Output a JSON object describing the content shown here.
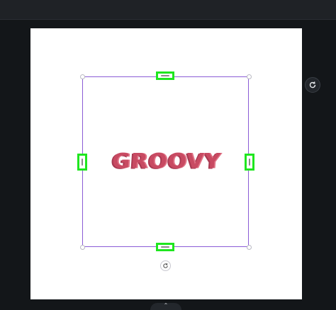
{
  "canvas": {
    "page_background": "#ffffff",
    "selection_color": "#8b5cd6",
    "handle_highlight_color": "#1fe61f"
  },
  "element": {
    "text": "GROOVY",
    "color": "#c84a62"
  },
  "icons": {
    "rotate_handle": "rotate-icon",
    "side_rotate": "rotate-icon",
    "bottom_tab": "chevron-up-icon"
  },
  "bottom_tab": {
    "glyph": "⌃"
  }
}
